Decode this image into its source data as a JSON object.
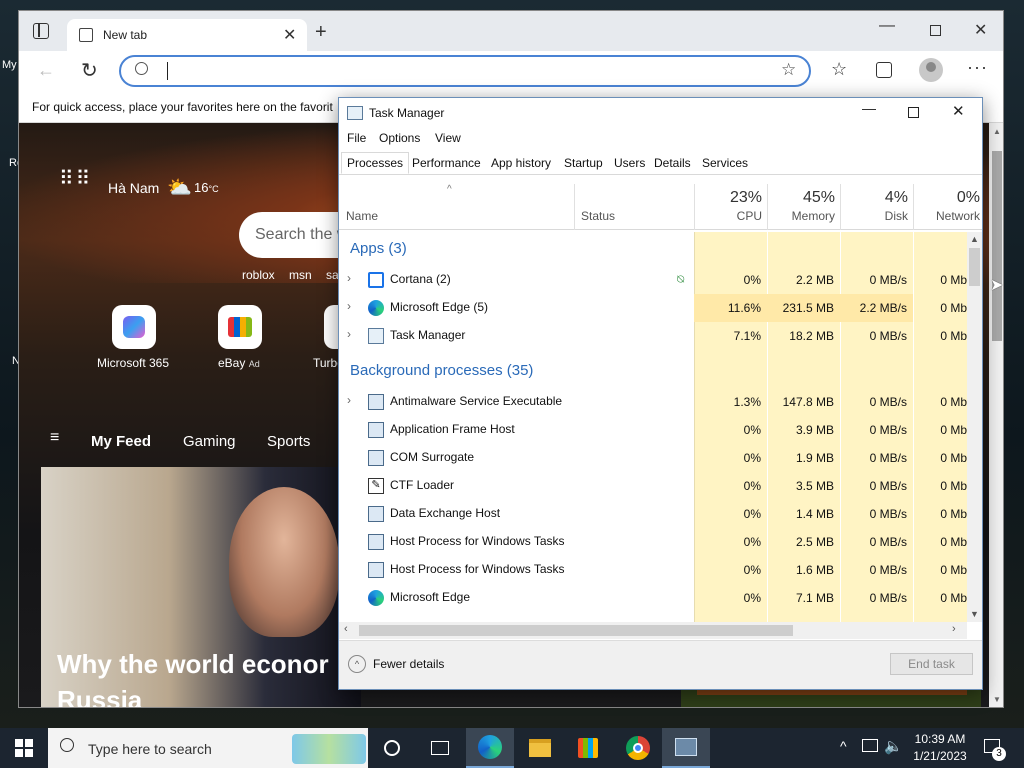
{
  "desktop": {
    "icons": [
      {
        "label": "My"
      },
      {
        "label": "Re"
      },
      {
        "label": "N"
      }
    ]
  },
  "browser": {
    "tab_title": "New tab",
    "address_value": "",
    "favorites_hint": "For quick access, place your favorites here on the favorites bar.",
    "favorites_hint_visible": "For quick access, place your favorites here on the favorit",
    "newtab": {
      "location": "Hà Nam",
      "temperature": "16",
      "temp_unit": "°C",
      "search_placeholder": "Search the w",
      "quick_links": [
        "roblox",
        "msn",
        "sa"
      ],
      "tiles": [
        {
          "label": "Microsoft 365"
        },
        {
          "label": "eBay",
          "badge": "Ad"
        },
        {
          "label": "Turbo"
        }
      ],
      "feed_nav": [
        "My Feed",
        "Gaming",
        "Sports"
      ],
      "headline_line1": "Why the world econor",
      "headline_line2": "Russia"
    }
  },
  "taskmanager": {
    "title": "Task Manager",
    "menu": [
      "File",
      "Options",
      "View"
    ],
    "tabs": [
      "Processes",
      "Performance",
      "App history",
      "Startup",
      "Users",
      "Details",
      "Services"
    ],
    "active_tab": "Processes",
    "columns": {
      "name": "Name",
      "status": "Status",
      "cpu": {
        "pct": "23%",
        "label": "CPU"
      },
      "memory": {
        "pct": "45%",
        "label": "Memory"
      },
      "disk": {
        "pct": "4%",
        "label": "Disk"
      },
      "network": {
        "pct": "0%",
        "label": "Network"
      }
    },
    "groups": {
      "apps": "Apps (3)",
      "background": "Background processes (35)"
    },
    "apps": [
      {
        "name": "Cortana (2)",
        "cpu": "0%",
        "mem": "2.2 MB",
        "disk": "0 MB/s",
        "net": "0 Mb",
        "icon": "cortana-icon"
      },
      {
        "name": "Microsoft Edge (5)",
        "cpu": "11.6%",
        "mem": "231.5 MB",
        "disk": "2.2 MB/s",
        "net": "0 Mb",
        "icon": "edge-icon"
      },
      {
        "name": "Task Manager",
        "cpu": "7.1%",
        "mem": "18.2 MB",
        "disk": "0 MB/s",
        "net": "0 Mb",
        "icon": "taskmanager-icon"
      }
    ],
    "background": [
      {
        "name": "Antimalware Service Executable",
        "cpu": "1.3%",
        "mem": "147.8 MB",
        "disk": "0 MB/s",
        "net": "0 Mb",
        "icon": "process-icon"
      },
      {
        "name": "Application Frame Host",
        "cpu": "0%",
        "mem": "3.9 MB",
        "disk": "0 MB/s",
        "net": "0 Mb",
        "icon": "process-icon"
      },
      {
        "name": "COM Surrogate",
        "cpu": "0%",
        "mem": "1.9 MB",
        "disk": "0 MB/s",
        "net": "0 Mb",
        "icon": "process-icon"
      },
      {
        "name": "CTF Loader",
        "cpu": "0%",
        "mem": "3.5 MB",
        "disk": "0 MB/s",
        "net": "0 Mb",
        "icon": "ctf-icon"
      },
      {
        "name": "Data Exchange Host",
        "cpu": "0%",
        "mem": "1.4 MB",
        "disk": "0 MB/s",
        "net": "0 Mb",
        "icon": "process-icon"
      },
      {
        "name": "Host Process for Windows Tasks",
        "cpu": "0%",
        "mem": "2.5 MB",
        "disk": "0 MB/s",
        "net": "0 Mb",
        "icon": "process-icon"
      },
      {
        "name": "Host Process for Windows Tasks",
        "cpu": "0%",
        "mem": "1.6 MB",
        "disk": "0 MB/s",
        "net": "0 Mb",
        "icon": "process-icon"
      },
      {
        "name": "Microsoft Edge",
        "cpu": "0%",
        "mem": "7.1 MB",
        "disk": "0 MB/s",
        "net": "0 Mb",
        "icon": "edge-icon"
      }
    ],
    "fewer_details": "Fewer details",
    "end_task": "End task"
  },
  "taskbar": {
    "search_placeholder": "Type here to search",
    "time": "10:39 AM",
    "date": "1/21/2023",
    "notification_count": "3"
  },
  "colors": {
    "accent": "#0078d4",
    "cpu_heat_low": "#fff4c4",
    "cpu_heat_mid": "#ffe9a8",
    "taskbar": "#1c2530"
  }
}
